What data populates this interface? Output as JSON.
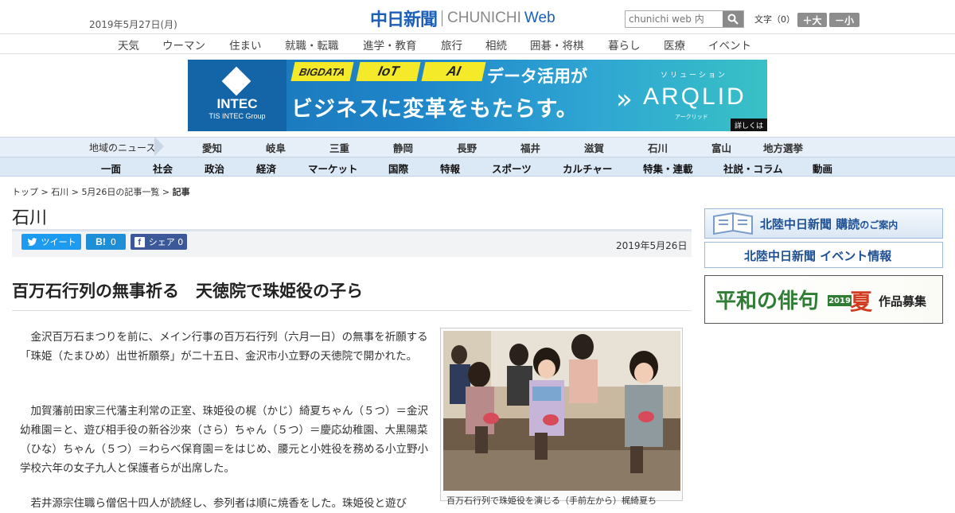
{
  "header": {
    "date": "2019年5月27日(月)",
    "logo_jp": "中日新聞",
    "logo_en": "CHUNICHI",
    "logo_web": "Web",
    "search_placeholder": "chunichi web 内",
    "font_size_label": "文字（0）",
    "font_bigger": "＋大",
    "font_smaller": "－小"
  },
  "topnav": [
    "天気",
    "ウーマン",
    "住まい",
    "就職・転職",
    "進学・教育",
    "旅行",
    "相続",
    "囲碁・将棋",
    "暮らし",
    "医療",
    "イベント"
  ],
  "banner": {
    "brand": "INTEC",
    "brand_sub": "TIS INTEC Group",
    "tag1": "BIGDATA",
    "tag2": "IoT",
    "tag3": "AI",
    "line1": "データ活用が",
    "line2": "ビジネスに変革をもたらす。",
    "solution": "ソリューション",
    "product": "ARQLID",
    "product_kana": "アークリッド",
    "detail": "詳しくは"
  },
  "region_nav": {
    "label": "地域のニュース",
    "items": [
      "愛知",
      "岐阜",
      "三重",
      "静岡",
      "長野",
      "福井",
      "滋賀",
      "石川",
      "富山",
      "地方選挙"
    ]
  },
  "category_nav": [
    "一面",
    "社会",
    "政治",
    "経済",
    "マーケット",
    "国際",
    "特報",
    "スポーツ",
    "カルチャー",
    "特集・連載",
    "社説・コラム",
    "動画"
  ],
  "breadcrumb": {
    "top": "トップ",
    "section": "石川",
    "list": "5月26日の記事一覧",
    "current": "記事",
    "sep": " > "
  },
  "section_title": "石川",
  "share": {
    "tweet": "ツイート",
    "hatena_count": "0",
    "facebook": "シェア",
    "facebook_count": "0"
  },
  "article": {
    "date": "2019年5月26日",
    "headline": "百万石行列の無事祈る　天徳院で珠姫役の子ら",
    "paragraphs": [
      "　金沢百万石まつりを前に、メイン行事の百万石行列（六月一日）の無事を祈願する「珠姫（たまひめ）出世祈願祭」が二十五日、金沢市小立野の天徳院で開かれた。",
      "　加賀藩前田家三代藩主利常の正室、珠姫役の梶（かじ）綺夏ちゃん（５つ）＝金沢幼稚園＝と、遊び相手役の新谷沙來（さら）ちゃん（５つ）＝慶応幼稚園、大黒陽菜（ひな）ちゃん（５つ）＝わらべ保育園＝をはじめ、腰元と小姓役を務める小立野小学校六年の女子九人と保護者らが出席した。",
      "　若井源宗住職ら僧侶十四人が読経し、参列者は順に焼香をした。珠姫役と遊び"
    ],
    "photo_caption": "百万石行列で珠姫役を演じる（手前左から）梶綺夏ち"
  },
  "sidebar": {
    "ad1_main": "北陸中日新聞 購読",
    "ad1_sub": "のご案内",
    "ad2": "北陸中日新聞 イベント情報",
    "ad3_a": "平和の俳句",
    "ad3_year": "2019",
    "ad3_season": "夏",
    "ad3_b": "作品募集"
  }
}
